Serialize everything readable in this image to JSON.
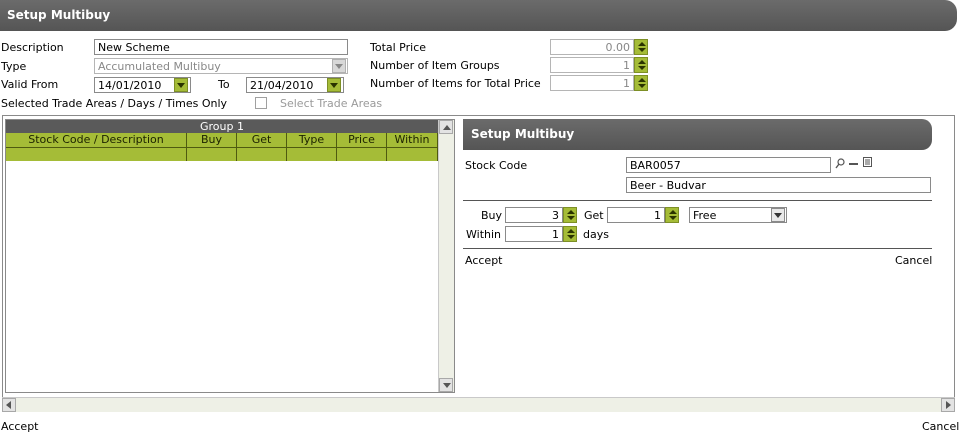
{
  "header": {
    "title": "Setup Multibuy"
  },
  "form": {
    "description_label": "Description",
    "description_value": "New Scheme",
    "type_label": "Type",
    "type_value": "Accumulated Multibuy",
    "valid_from_label": "Valid From",
    "valid_from_value": "14/01/2010",
    "to_label": "To",
    "to_value": "21/04/2010",
    "selected_label": "Selected Trade Areas / Days / Times Only",
    "select_trade_areas_label": "Select Trade Areas",
    "total_price_label": "Total Price",
    "total_price_value": "0.00",
    "item_groups_label": "Number of Item Groups",
    "item_groups_value": "1",
    "items_total_label": "Number of Items for Total Price",
    "items_total_value": "1"
  },
  "grid": {
    "group_title": "Group 1",
    "columns": [
      "Stock Code / Description",
      "Buy",
      "Get",
      "Type",
      "Price",
      "Within"
    ]
  },
  "sub": {
    "title": "Setup Multibuy",
    "stock_code_label": "Stock Code",
    "stock_code_value": "BAR0057",
    "description_value": "Beer - Budvar",
    "buy_label": "Buy",
    "buy_value": "3",
    "get_label": "Get",
    "get_value": "1",
    "type_value": "Free",
    "within_label": "Within",
    "within_value": "1",
    "days_label": "days",
    "accept_label": "Accept",
    "cancel_label": "Cancel"
  },
  "footer": {
    "accept_label": "Accept",
    "cancel_label": "Cancel"
  },
  "icons": {
    "lookup": "magnifier-icon",
    "clear": "dash-icon",
    "details": "list-icon"
  },
  "colors": {
    "accent_green": "#a5bc37",
    "header_grey": "#5f5f5f"
  }
}
